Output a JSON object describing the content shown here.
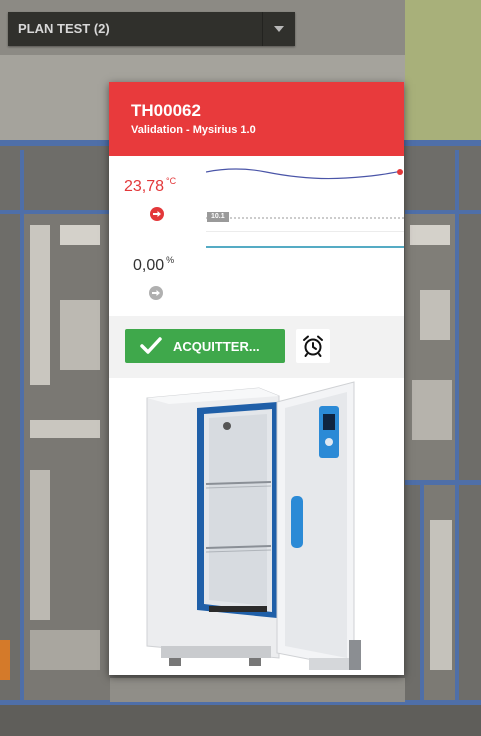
{
  "plan_selector": {
    "label": "PLAN TEST (2)"
  },
  "device": {
    "id": "TH00062",
    "subtitle": "Validation - Mysirius 1.0",
    "header_color": "#e83a3c"
  },
  "readings": [
    {
      "value": "23,78",
      "unit": "°C",
      "status": "alarm",
      "color": "#e3383a",
      "icon": "arrow-right-circle-icon"
    },
    {
      "value": "0,00",
      "unit": "%",
      "status": "normal",
      "color": "#333333",
      "icon": "arrow-right-circle-icon"
    }
  ],
  "chart": {
    "tag": "10.1"
  },
  "actions": {
    "acknowledge_label": "ACQUITTER...",
    "acknowledge_color": "#3fa84b",
    "alarm_icon": "alarm-clock-icon"
  },
  "image": {
    "subject": "laboratory incubator with open door"
  }
}
